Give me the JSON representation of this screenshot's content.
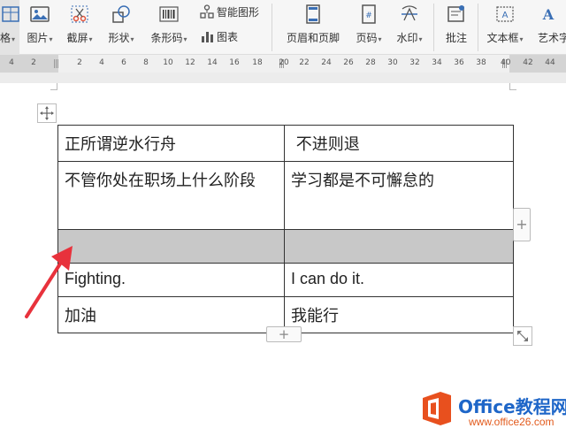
{
  "ribbon": {
    "left_cut_label": "格",
    "picture_label": "图片",
    "screenshot_label": "截屏",
    "shape_label": "形状",
    "barcode_label": "条形码",
    "smart_graphic_label": "智能图形",
    "chart_label": "图表",
    "header_footer_label": "页眉和页脚",
    "page_number_label": "页码",
    "watermark_label": "水印",
    "comment_label": "批注",
    "textbox_label": "文本框",
    "art_text_label": "艺术字",
    "caret": "▾"
  },
  "ruler": {
    "left_ticks": [
      "4",
      "2"
    ],
    "ticks": [
      "2",
      "4",
      "6",
      "8",
      "10",
      "12",
      "14",
      "16",
      "18",
      "20",
      "22",
      "24",
      "26",
      "28",
      "30",
      "32",
      "34",
      "36",
      "38",
      "40"
    ],
    "right_ticks": [
      "42",
      "44"
    ]
  },
  "table": {
    "rows": [
      [
        "正所谓逆水行舟",
        " 不进则退"
      ],
      [
        "不管你处在职场上什么阶段",
        "学习都是不可懈怠的"
      ],
      [
        "",
        ""
      ],
      [
        "Fighting.",
        "I can do it."
      ],
      [
        "加油",
        "我能行"
      ]
    ],
    "shaded_row_color": "#c8c8c8",
    "add_col_symbol": "+",
    "add_row_symbol": "+"
  },
  "annotation": {
    "arrow_color": "#e8323c"
  },
  "watermark": {
    "title": "Office教程网",
    "url": "www.office26.com",
    "logo_color": "#e8501e"
  }
}
